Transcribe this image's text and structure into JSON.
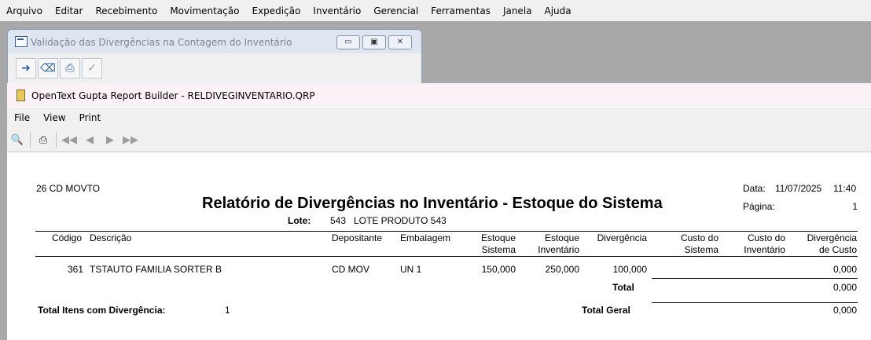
{
  "app_menu": [
    "Arquivo",
    "Editar",
    "Recebimento",
    "Movimentação",
    "Expedição",
    "Inventário",
    "Gerencial",
    "Ferramentas",
    "Janela",
    "Ajuda"
  ],
  "bg_window": {
    "title": "Validação das Divergências na Contagem do Inventário"
  },
  "report_window": {
    "title": "OpenText Gupta Report Builder - RELDIVEGINVENTARIO.QRP",
    "menu": {
      "file": "File",
      "view": "View",
      "print": "Print"
    }
  },
  "report": {
    "company": "26 CD MOVTO",
    "title": "Relatório de Divergências no Inventário - Estoque do Sistema",
    "date_label": "Data:",
    "date": "11/07/2025",
    "time": "11:40",
    "page_label": "Página:",
    "page": "1",
    "lote_label": "Lote:",
    "lote_num": "543",
    "lote_desc": "LOTE PRODUTO 543",
    "columns": {
      "codigo": "Código",
      "descricao": "Descrição",
      "depositante": "Depositante",
      "embalagem": "Embalagem",
      "estoque_sistema_1": "Estoque",
      "estoque_sistema_2": "Sistema",
      "estoque_inventario_1": "Estoque",
      "estoque_inventario_2": "Inventário",
      "divergencia": "Divergência",
      "custo_sistema_1": "Custo do",
      "custo_sistema_2": "Sistema",
      "custo_inventario_1": "Custo do",
      "custo_inventario_2": "Inventário",
      "div_custo_1": "Divergência",
      "div_custo_2": "de Custo"
    },
    "row": {
      "codigo": "361",
      "descricao": "TSTAUTO FAMILIA SORTER B",
      "depositante": "CD MOV",
      "embalagem": "UN 1",
      "estoque_sistema": "150,000",
      "estoque_inventario": "250,000",
      "divergencia": "100,000",
      "div_custo": "0,000"
    },
    "total_label": "Total",
    "total_value": "0,000",
    "total_itens_label": "Total Itens com Divergência:",
    "total_itens_value": "1",
    "total_geral_label": "Total Geral",
    "total_geral_value": "0,000"
  }
}
